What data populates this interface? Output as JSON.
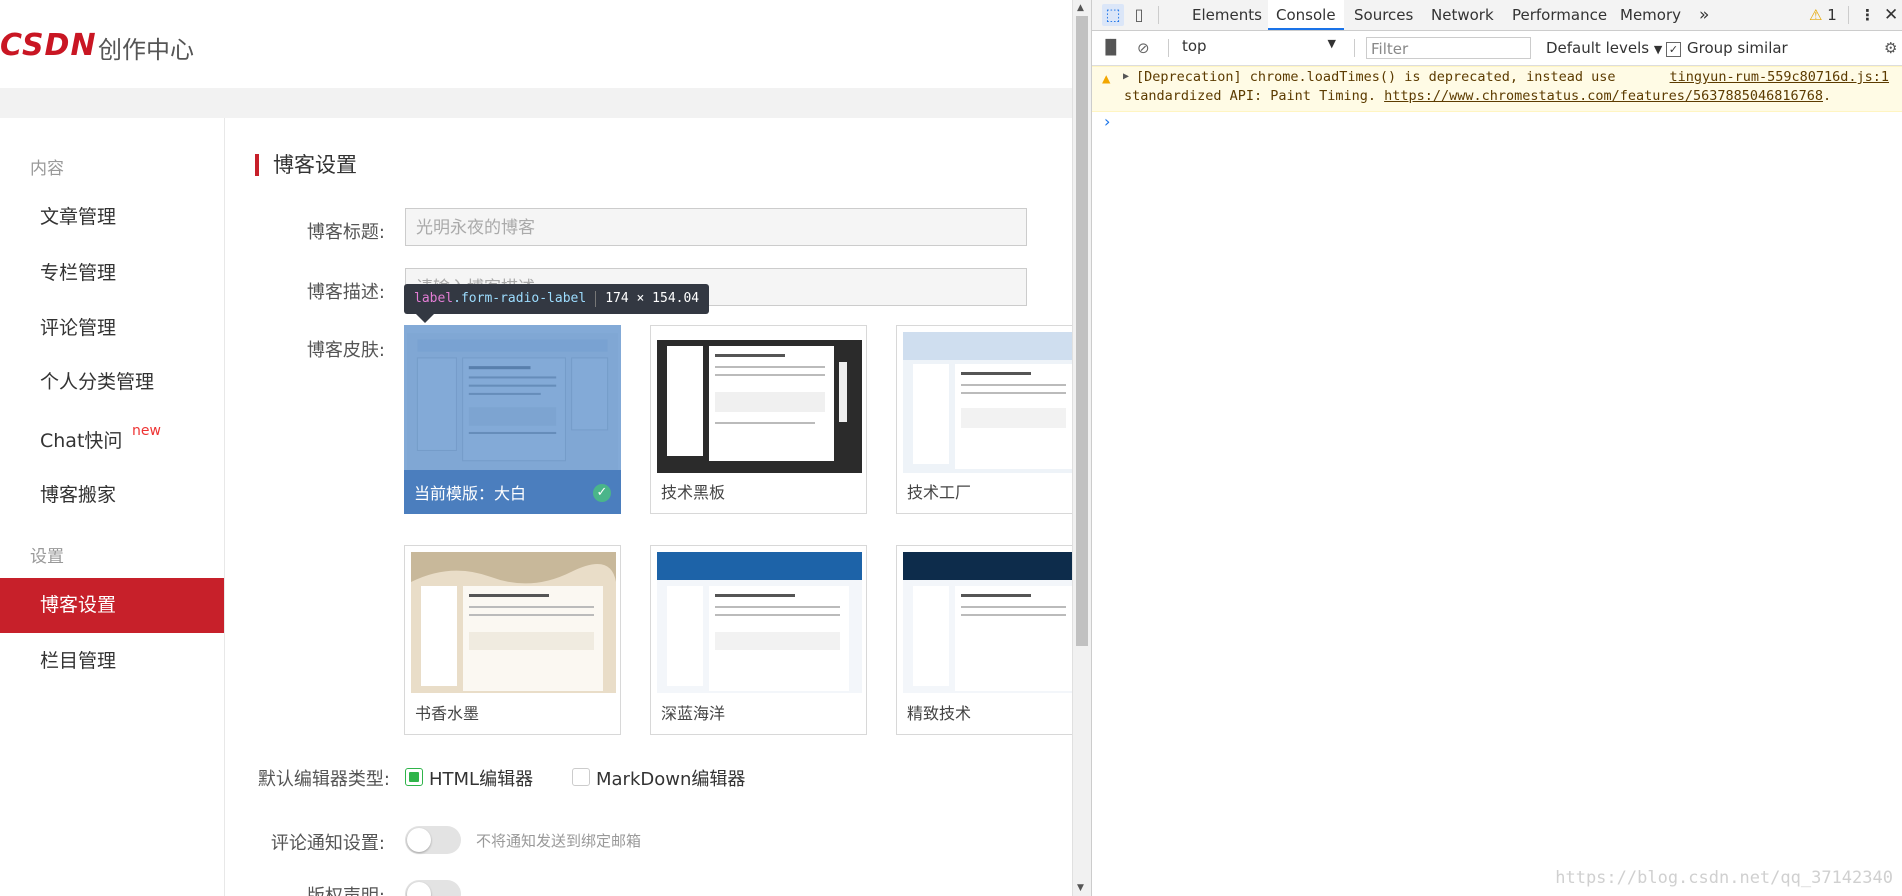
{
  "page": {
    "logo_brand": "CSDN",
    "logo_sub": "创作中心"
  },
  "sidebar": {
    "section_content": "内容",
    "items": [
      {
        "label": "文章管理"
      },
      {
        "label": "专栏管理"
      },
      {
        "label": "评论管理"
      },
      {
        "label": "个人分类管理"
      },
      {
        "label": "Chat快问",
        "badge": "new"
      },
      {
        "label": "博客搬家"
      }
    ],
    "section_settings": "设置",
    "settings_items": [
      {
        "label": "博客设置",
        "active": true
      },
      {
        "label": "栏目管理"
      }
    ],
    "active_color": "#c7202a"
  },
  "form": {
    "section_title": "博客设置",
    "title_label": "博客标题:",
    "title_placeholder": "光明永夜的博客",
    "desc_label": "博客描述:",
    "desc_placeholder": "请输入博客描述",
    "skin_label": "博客皮肤:",
    "skins": [
      {
        "caption": "当前模版：大白",
        "selected": true
      },
      {
        "caption": "技术黑板"
      },
      {
        "caption": "技术工厂"
      },
      {
        "caption": "书香水墨"
      },
      {
        "caption": "深蓝海洋"
      },
      {
        "caption": "精致技术"
      }
    ],
    "editor_label": "默认编辑器类型:",
    "editor_options": [
      {
        "label": "HTML编辑器",
        "checked": true
      },
      {
        "label": "MarkDown编辑器",
        "checked": false
      }
    ],
    "notify_label": "评论通知设置:",
    "notify_text": "不将通知发送到绑定邮箱",
    "copyright_label": "版权声明:"
  },
  "inspector_tooltip": {
    "tag": "label",
    "cls": ".form-radio-label",
    "size": "174 × 154.04"
  },
  "devtools": {
    "tabs": [
      "Elements",
      "Console",
      "Sources",
      "Network",
      "Performance",
      "Memory"
    ],
    "active_tab": "Console",
    "more_tabs": "»",
    "warning_count": "1",
    "context": "top",
    "filter_placeholder": "Filter",
    "levels": "Default levels",
    "group_similar": "Group similar",
    "warning": {
      "line1": "[Deprecation] chrome.loadTimes() is deprecated, instead use",
      "line2_prefix": "standardized API: Paint Timing. ",
      "link": "https://www.chromestatus.com/features/5637885046816768",
      "line2_suffix": ".",
      "source": "tingyun-rum-559c80716d.js:1"
    },
    "prompt": "›"
  },
  "watermark": "https://blog.csdn.net/qq_37142340"
}
